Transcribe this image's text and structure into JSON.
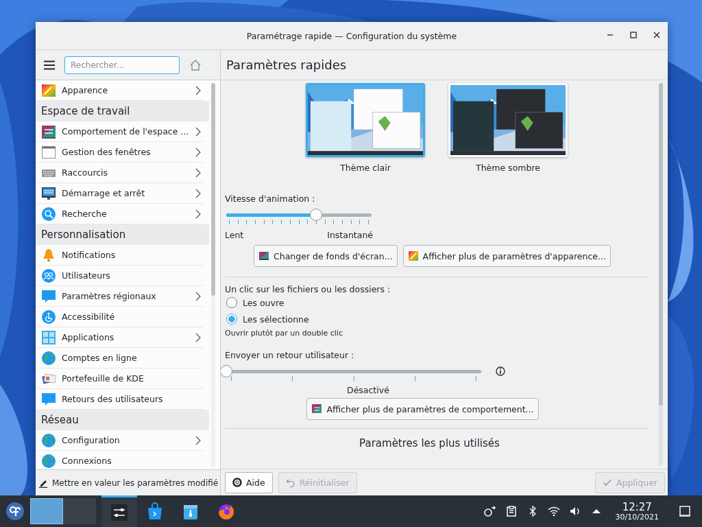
{
  "window": {
    "title": "Paramétrage rapide — Configuration du système"
  },
  "sidebar": {
    "search": {
      "placeholder": "Rechercher..."
    },
    "items": [
      {
        "kind": "entry",
        "label": "Apparence",
        "has_submenu": true
      },
      {
        "kind": "category",
        "label": "Espace de travail"
      },
      {
        "kind": "entry",
        "label": "Comportement de l'espace ...",
        "has_submenu": true
      },
      {
        "kind": "entry",
        "label": "Gestion des fenêtres",
        "has_submenu": true
      },
      {
        "kind": "entry",
        "label": "Raccourcis",
        "has_submenu": true
      },
      {
        "kind": "entry",
        "label": "Démarrage et arrêt",
        "has_submenu": true
      },
      {
        "kind": "entry",
        "label": "Recherche",
        "has_submenu": true
      },
      {
        "kind": "category",
        "label": "Personnalisation"
      },
      {
        "kind": "entry",
        "label": "Notifications",
        "has_submenu": false
      },
      {
        "kind": "entry",
        "label": "Utilisateurs",
        "has_submenu": false
      },
      {
        "kind": "entry",
        "label": "Paramètres régionaux",
        "has_submenu": true
      },
      {
        "kind": "entry",
        "label": "Accessibilité",
        "has_submenu": false
      },
      {
        "kind": "entry",
        "label": "Applications",
        "has_submenu": true
      },
      {
        "kind": "entry",
        "label": "Comptes en ligne",
        "has_submenu": false
      },
      {
        "kind": "entry",
        "label": "Portefeuille de KDE",
        "has_submenu": false
      },
      {
        "kind": "entry",
        "label": "Retours des utilisateurs",
        "has_submenu": false
      },
      {
        "kind": "category",
        "label": "Réseau"
      },
      {
        "kind": "entry",
        "label": "Configuration",
        "has_submenu": true
      },
      {
        "kind": "entry",
        "label": "Connexions",
        "has_submenu": false
      }
    ],
    "footer": "Mettre en valeur les paramètres modifié"
  },
  "page": {
    "title": "Paramètres rapides",
    "themes": [
      {
        "label": "Thème clair",
        "selected": true
      },
      {
        "label": "Thème sombre",
        "selected": false
      }
    ],
    "animation_speed": {
      "label": "Vitesse d'animation :",
      "level": 0.62,
      "min_label": "Lent",
      "max_label": "Instantané"
    },
    "appearance_buttons": [
      "Changer de fonds d'écran...",
      "Afficher plus de paramètres d'apparence..."
    ],
    "click_behavior": {
      "label": "Un clic sur les fichiers ou les dossiers :",
      "options": [
        {
          "label": "Les ouvre",
          "selected": false
        },
        {
          "label": "Les sélectionne",
          "selected": true
        }
      ],
      "hint": "Ouvrir plutôt par un double clic"
    },
    "feedback": {
      "label": "Envoyer un retour utilisateur :",
      "level": 0,
      "value_label": "Désactivé"
    },
    "behavior_button": "Afficher plus de paramètres de comportement...",
    "section_heading": "Paramètres les plus utilisés"
  },
  "footer_buttons": [
    {
      "label": "Aide",
      "disabled": false
    },
    {
      "label": "Réinitialiser",
      "disabled": true
    },
    {
      "label": "Appliquer",
      "disabled": true
    }
  ],
  "taskbar": {
    "desktops": [
      {
        "selected": true
      },
      {
        "selected": false
      }
    ],
    "tasks": [
      {
        "selected": true
      },
      {
        "selected": false
      },
      {
        "selected": false
      },
      {
        "selected": false
      }
    ],
    "clock": {
      "time": "12:27",
      "date": "30/10/2021"
    }
  }
}
